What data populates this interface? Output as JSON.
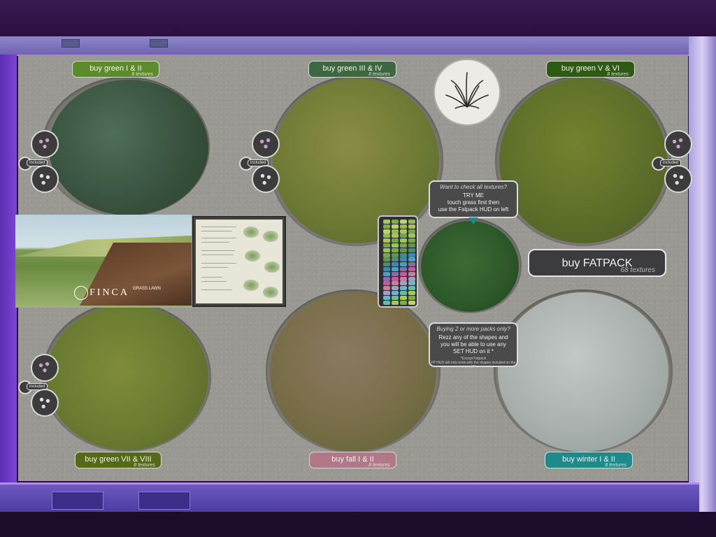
{
  "buttons": {
    "green_1_2": {
      "label": "buy green I & II",
      "sub": "8 textures",
      "color": "#5d8a2c"
    },
    "green_3_4": {
      "label": "buy green III & IV",
      "sub": "8 textures",
      "color": "#3e6640"
    },
    "green_5_6": {
      "label": "buy green V & VI",
      "sub": "8 textures",
      "color": "#2f5a16"
    },
    "green_7_8": {
      "label": "buy green VII & VIII",
      "sub": "8 textures",
      "color": "#556a18"
    },
    "fall_1_2": {
      "label": "buy fall I & II",
      "sub": "8 textures",
      "color": "#b07888"
    },
    "winter_1_2": {
      "label": "buy winter I & II",
      "sub": "8 textures",
      "color": "#1e8a8c"
    }
  },
  "included_label": "included",
  "fatpack": {
    "label": "buy FATPACK",
    "sub": "68 textures"
  },
  "tooltip_top": {
    "title": "Want to check all textures?",
    "line1": "TRY ME",
    "line2": "touch grass first then",
    "line3": "use the Fatpack HUD on left"
  },
  "tooltip_bottom": {
    "title": "Buying 2 or more packs only?",
    "line1": "Rezz any of the shapes and",
    "line2": "you will be able to use any",
    "line3": "SET HUD on it *",
    "small1": "*Except Fatpack",
    "small2": "FP HUD will only work with the shapes included on the FP"
  },
  "photo": {
    "brand": "FINCA",
    "brand_sub": "GRASS LAWN"
  },
  "colors": {
    "swatch_green1": "#3a5a48",
    "swatch_green3": "#6e7a34",
    "swatch_green5": "#5d6e2a",
    "swatch_green7": "#6a7a30",
    "swatch_fall": "#7a6e4a",
    "swatch_winter": "#a9b0ae",
    "swatch_center": "#2e5a2a"
  }
}
